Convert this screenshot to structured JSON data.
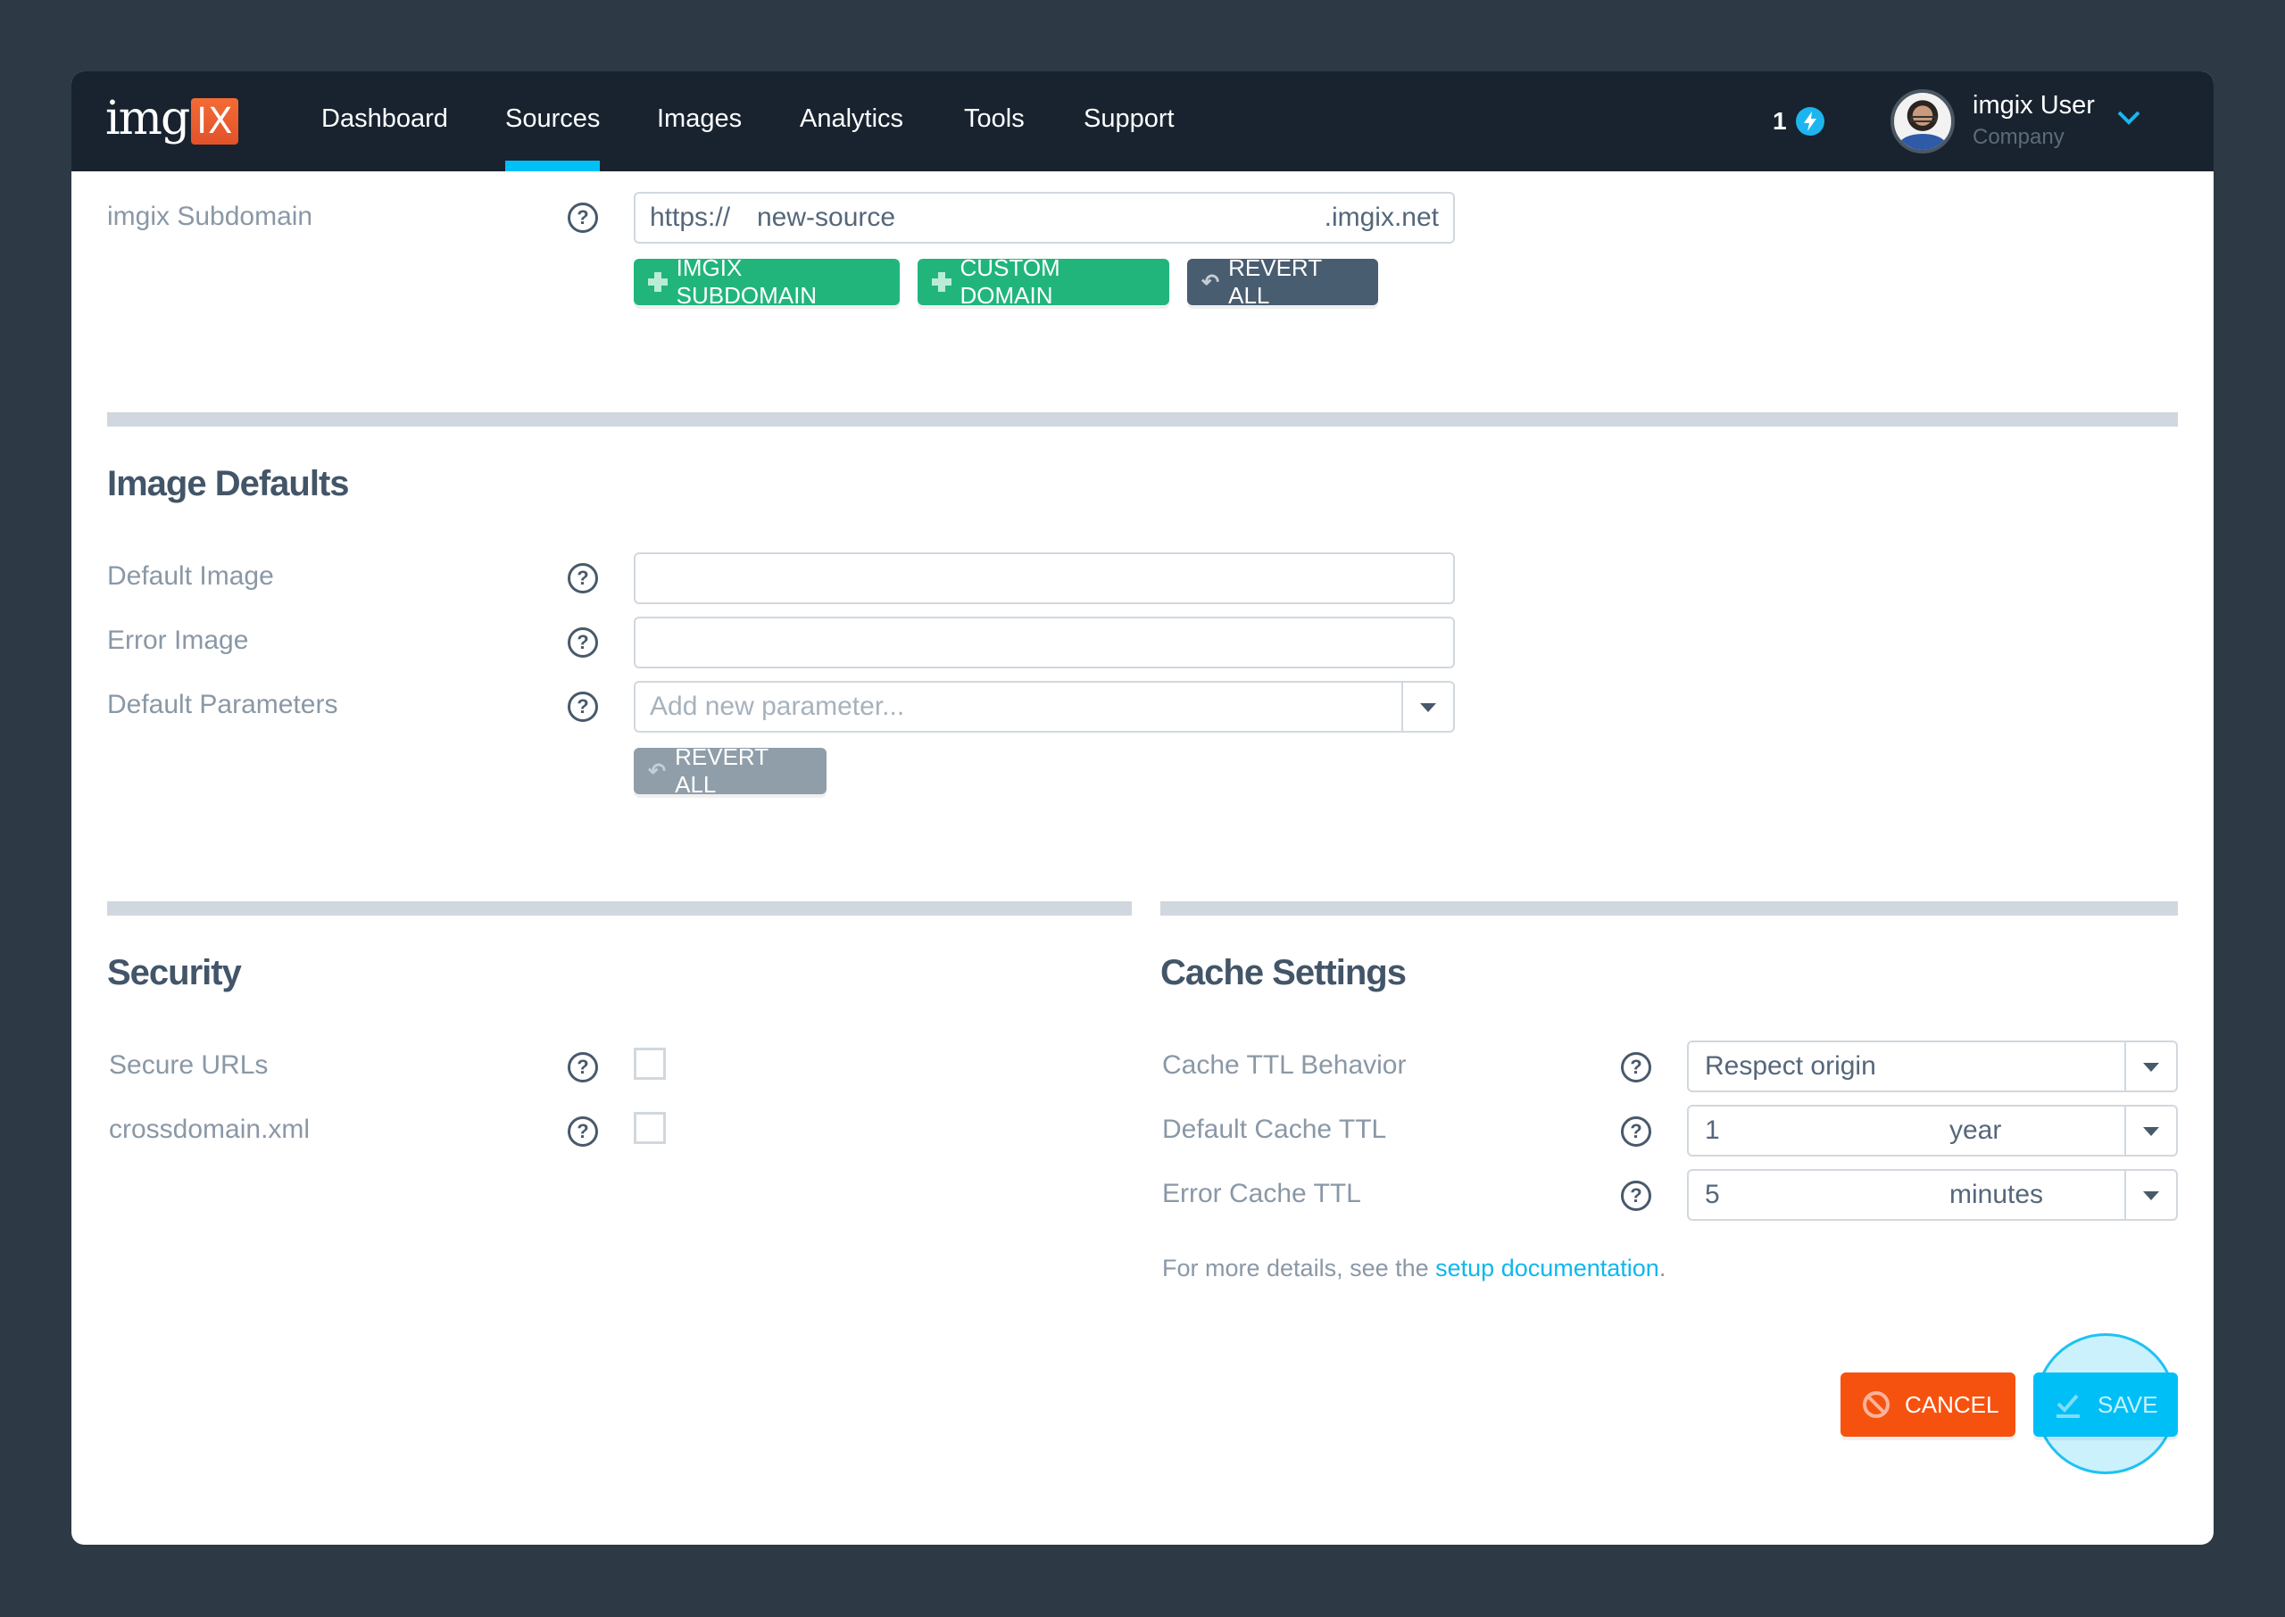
{
  "app": {
    "logo_text": "img",
    "logo_badge": "IX"
  },
  "nav": {
    "items": [
      {
        "label": "Dashboard",
        "active": false
      },
      {
        "label": "Sources",
        "active": true
      },
      {
        "label": "Images",
        "active": false
      },
      {
        "label": "Analytics",
        "active": false
      },
      {
        "label": "Tools",
        "active": false
      },
      {
        "label": "Support",
        "active": false
      }
    ],
    "notification_count": "1",
    "notification_icon": "bolt-icon",
    "user": {
      "name": "imgix User",
      "company": "Company"
    }
  },
  "subdomain": {
    "label": "imgix Subdomain",
    "prefix": "https://",
    "value": "new-source",
    "suffix": ".imgix.net",
    "buttons": {
      "add_subdomain": "IMGIX SUBDOMAIN",
      "add_custom": "CUSTOM DOMAIN",
      "revert": "REVERT ALL"
    }
  },
  "image_defaults": {
    "title": "Image Defaults",
    "default_image": {
      "label": "Default Image",
      "value": ""
    },
    "error_image": {
      "label": "Error Image",
      "value": ""
    },
    "default_parameters": {
      "label": "Default Parameters",
      "placeholder": "Add new parameter..."
    },
    "revert": "REVERT ALL"
  },
  "security": {
    "title": "Security",
    "secure_urls": {
      "label": "Secure URLs",
      "checked": false
    },
    "crossdomain": {
      "label": "crossdomain.xml",
      "checked": false
    }
  },
  "cache": {
    "title": "Cache Settings",
    "ttl_behavior": {
      "label": "Cache TTL Behavior",
      "value": "Respect origin"
    },
    "default_ttl": {
      "label": "Default Cache TTL",
      "amount": "1",
      "unit": "year"
    },
    "error_ttl": {
      "label": "Error Cache TTL",
      "amount": "5",
      "unit": "minutes"
    },
    "note_prefix": "For more details, see the ",
    "note_link": "setup documentation",
    "note_suffix": "."
  },
  "actions": {
    "cancel": "CANCEL",
    "save": "SAVE"
  },
  "colors": {
    "accent": "#00c0f7",
    "green": "#21b57c",
    "cancel": "#f6520f",
    "navbar": "#18232f"
  }
}
